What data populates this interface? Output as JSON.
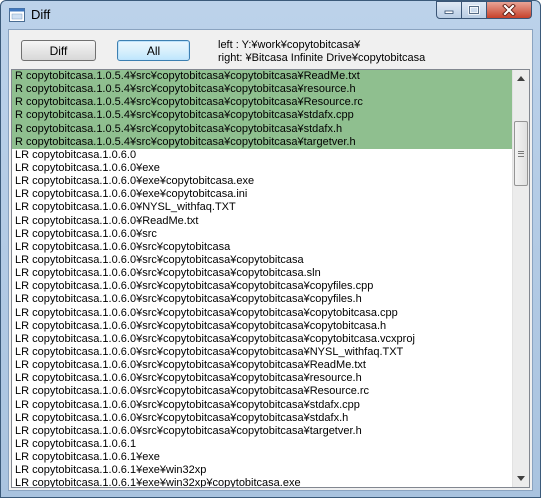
{
  "window": {
    "title": "Diff",
    "controls": {
      "minimize": "minimize-icon",
      "maximize": "maximize-icon",
      "close": "close-icon"
    }
  },
  "toolbar": {
    "diff_label": "Diff",
    "all_label": "All",
    "left_path": "left : Y:¥work¥copytobitcasa¥",
    "right_path": "right: ¥Bitcasa Infinite Drive¥copytobitcasa"
  },
  "colors": {
    "highlight": "#8fbf8f",
    "title_bar": "#bcd2ea",
    "close_button": "#c7412a"
  },
  "list": {
    "rows": [
      {
        "text": "R copytobitcasa.1.0.5.4¥src¥copytobitcasa¥copytobitcasa¥ReadMe.txt",
        "highlight": true
      },
      {
        "text": "R copytobitcasa.1.0.5.4¥src¥copytobitcasa¥copytobitcasa¥resource.h",
        "highlight": true
      },
      {
        "text": "R copytobitcasa.1.0.5.4¥src¥copytobitcasa¥copytobitcasa¥Resource.rc",
        "highlight": true
      },
      {
        "text": "R copytobitcasa.1.0.5.4¥src¥copytobitcasa¥copytobitcasa¥stdafx.cpp",
        "highlight": true
      },
      {
        "text": "R copytobitcasa.1.0.5.4¥src¥copytobitcasa¥copytobitcasa¥stdafx.h",
        "highlight": true
      },
      {
        "text": "R copytobitcasa.1.0.5.4¥src¥copytobitcasa¥copytobitcasa¥targetver.h",
        "highlight": true
      },
      {
        "text": "LR copytobitcasa.1.0.6.0",
        "highlight": false
      },
      {
        "text": "LR copytobitcasa.1.0.6.0¥exe",
        "highlight": false
      },
      {
        "text": "LR copytobitcasa.1.0.6.0¥exe¥copytobitcasa.exe",
        "highlight": false
      },
      {
        "text": "LR copytobitcasa.1.0.6.0¥exe¥copytobitcasa.ini",
        "highlight": false
      },
      {
        "text": "LR copytobitcasa.1.0.6.0¥NYSL_withfaq.TXT",
        "highlight": false
      },
      {
        "text": "LR copytobitcasa.1.0.6.0¥ReadMe.txt",
        "highlight": false
      },
      {
        "text": "LR copytobitcasa.1.0.6.0¥src",
        "highlight": false
      },
      {
        "text": "LR copytobitcasa.1.0.6.0¥src¥copytobitcasa",
        "highlight": false
      },
      {
        "text": "LR copytobitcasa.1.0.6.0¥src¥copytobitcasa¥copytobitcasa",
        "highlight": false
      },
      {
        "text": "LR copytobitcasa.1.0.6.0¥src¥copytobitcasa¥copytobitcasa.sln",
        "highlight": false
      },
      {
        "text": "LR copytobitcasa.1.0.6.0¥src¥copytobitcasa¥copytobitcasa¥copyfiles.cpp",
        "highlight": false
      },
      {
        "text": "LR copytobitcasa.1.0.6.0¥src¥copytobitcasa¥copytobitcasa¥copyfiles.h",
        "highlight": false
      },
      {
        "text": "LR copytobitcasa.1.0.6.0¥src¥copytobitcasa¥copytobitcasa¥copytobitcasa.cpp",
        "highlight": false
      },
      {
        "text": "LR copytobitcasa.1.0.6.0¥src¥copytobitcasa¥copytobitcasa¥copytobitcasa.h",
        "highlight": false
      },
      {
        "text": "LR copytobitcasa.1.0.6.0¥src¥copytobitcasa¥copytobitcasa¥copytobitcasa.vcxproj",
        "highlight": false
      },
      {
        "text": "LR copytobitcasa.1.0.6.0¥src¥copytobitcasa¥copytobitcasa¥NYSL_withfaq.TXT",
        "highlight": false
      },
      {
        "text": "LR copytobitcasa.1.0.6.0¥src¥copytobitcasa¥copytobitcasa¥ReadMe.txt",
        "highlight": false
      },
      {
        "text": "LR copytobitcasa.1.0.6.0¥src¥copytobitcasa¥copytobitcasa¥resource.h",
        "highlight": false
      },
      {
        "text": "LR copytobitcasa.1.0.6.0¥src¥copytobitcasa¥copytobitcasa¥Resource.rc",
        "highlight": false
      },
      {
        "text": "LR copytobitcasa.1.0.6.0¥src¥copytobitcasa¥copytobitcasa¥stdafx.cpp",
        "highlight": false
      },
      {
        "text": "LR copytobitcasa.1.0.6.0¥src¥copytobitcasa¥copytobitcasa¥stdafx.h",
        "highlight": false
      },
      {
        "text": "LR copytobitcasa.1.0.6.0¥src¥copytobitcasa¥copytobitcasa¥targetver.h",
        "highlight": false
      },
      {
        "text": "LR copytobitcasa.1.0.6.1",
        "highlight": false
      },
      {
        "text": "LR copytobitcasa.1.0.6.1¥exe",
        "highlight": false
      },
      {
        "text": "LR copytobitcasa.1.0.6.1¥exe¥win32xp",
        "highlight": false
      },
      {
        "text": "LR copytobitcasa.1.0.6.1¥exe¥win32xp¥copytobitcasa.exe",
        "highlight": false
      }
    ]
  },
  "scrollbar": {
    "up_icon": "scroll-up-arrow-icon",
    "down_icon": "scroll-down-arrow-icon",
    "position": 0.11
  }
}
